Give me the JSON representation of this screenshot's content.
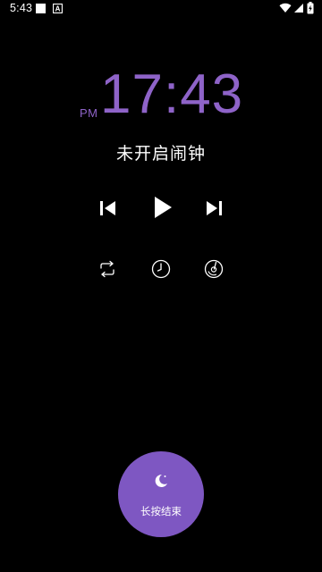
{
  "status_bar": {
    "time": "5:43",
    "icons": [
      "notification-square-icon",
      "notification-a-icon",
      "wifi-icon",
      "signal-icon",
      "battery-charging-icon"
    ]
  },
  "clock": {
    "ampm": "PM",
    "time": "17:43",
    "color": "#8e63c8"
  },
  "alarm": {
    "status_text": "未开启闹钟"
  },
  "controls": {
    "icons": [
      "skip-previous-icon",
      "play-icon",
      "skip-next-icon"
    ]
  },
  "modes": {
    "icons": [
      "repeat-icon",
      "clock-icon",
      "timer-icon"
    ]
  },
  "end_button": {
    "label": "长按结束",
    "icon": "moon-icon",
    "color": "#7e57c2"
  }
}
